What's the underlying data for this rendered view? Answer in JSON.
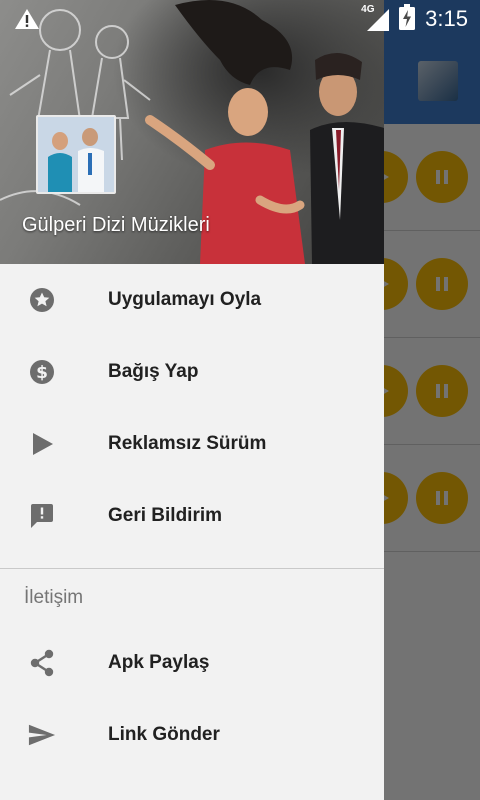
{
  "status_bar": {
    "time": "3:15",
    "network_label": "4G",
    "icons": [
      "warning-icon",
      "signal-icon",
      "battery-charging-icon"
    ]
  },
  "drawer": {
    "header_title": "Gülperi Dizi Müzikleri",
    "menu_items": [
      {
        "label": "Uygulamayı Oyla",
        "icon": "star-circle-icon"
      },
      {
        "label": "Bağış Yap",
        "icon": "dollar-circle-icon"
      },
      {
        "label": "Reklamsız Sürüm",
        "icon": "play-icon"
      },
      {
        "label": "Geri Bildirim",
        "icon": "feedback-icon"
      }
    ],
    "section_title": "İletişim",
    "contact_items": [
      {
        "label": "Apk Paylaş",
        "icon": "share-icon"
      },
      {
        "label": "Link Gönder",
        "icon": "send-icon"
      }
    ]
  },
  "background_app": {
    "toolbar_color": "#3f7fd1",
    "button_color": "#ffc107",
    "row_icons": [
      "play-icon",
      "pause-icon"
    ]
  }
}
